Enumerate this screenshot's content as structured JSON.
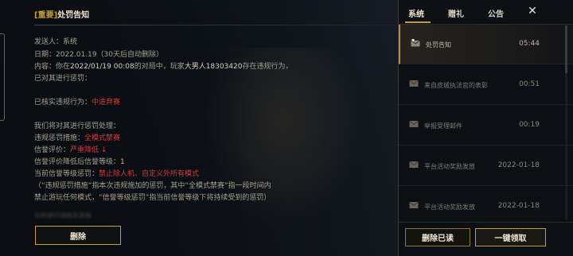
{
  "mail": {
    "title_tag": "[重要]",
    "title": "处罚告知",
    "sender_label": "发送人：",
    "sender": "系统",
    "date_label": "日期：",
    "date": "2022.01.19",
    "date_note": "（30天后自动删除）",
    "body": {
      "l1_pre": "内容：你在",
      "l1_time": "2022/01/19 00:08",
      "l1_mid": "的对局中，玩家",
      "l1_player": "大男人18303420",
      "l1_post": "存在违规行为，",
      "l2": "已对其进行惩罚：",
      "l3_label": "已核实违规行为：",
      "l3_value": "中途弃赛",
      "l4": "我们将对其进行惩罚处理：",
      "l5_label": "违规惩罚措施：",
      "l5_value": "全模式禁赛",
      "l6_label": "信誉评价：",
      "l6_value": "严重降低 ↓",
      "l7_label": "信誉评价降低后信誉等级：",
      "l7_value": "1",
      "l8_label": "当前信誉等级惩罚：",
      "l8_value": "禁止除人机、自定义外所有模式",
      "l9": "（“违规惩罚措施”指本次违规施加的惩罚，其中“全模式禁赛”指一段时间内",
      "l10": "禁止游玩任何模式，“信誉等级惩罚”指当前信誉等级下将持续受到的惩罚）"
    },
    "faded_line": "如有疑问请联系客服",
    "delete_button": "删除"
  },
  "sidebar": {
    "tabs": [
      {
        "label": "系统"
      },
      {
        "label": "赠礼"
      },
      {
        "label": "公告"
      }
    ],
    "close_label": "✕",
    "items": [
      {
        "subject": "处罚告知",
        "time": "05:44",
        "active": true,
        "icon": "mail-open-icon"
      },
      {
        "subject": "来自皮城执法官的表彰",
        "time": "00:51",
        "active": false,
        "icon": "mail-icon"
      },
      {
        "subject": "举报受理邮件",
        "time": "00:19",
        "active": false,
        "icon": "mail-icon"
      },
      {
        "subject": "平台活动奖励发放",
        "time": "2022-01-18",
        "active": false,
        "icon": "mail-icon"
      },
      {
        "subject": "平台活动奖励发放",
        "time": "2022-01-18",
        "active": false,
        "icon": "mail-icon"
      }
    ],
    "delete_read_button": "删除已读",
    "claim_all_button": "一键领取"
  },
  "colors": {
    "gold": "#c89b3c",
    "penalty_red": "#d23a3a",
    "level_gold": "#e0b846",
    "panel_bg": "#0c0f14"
  }
}
